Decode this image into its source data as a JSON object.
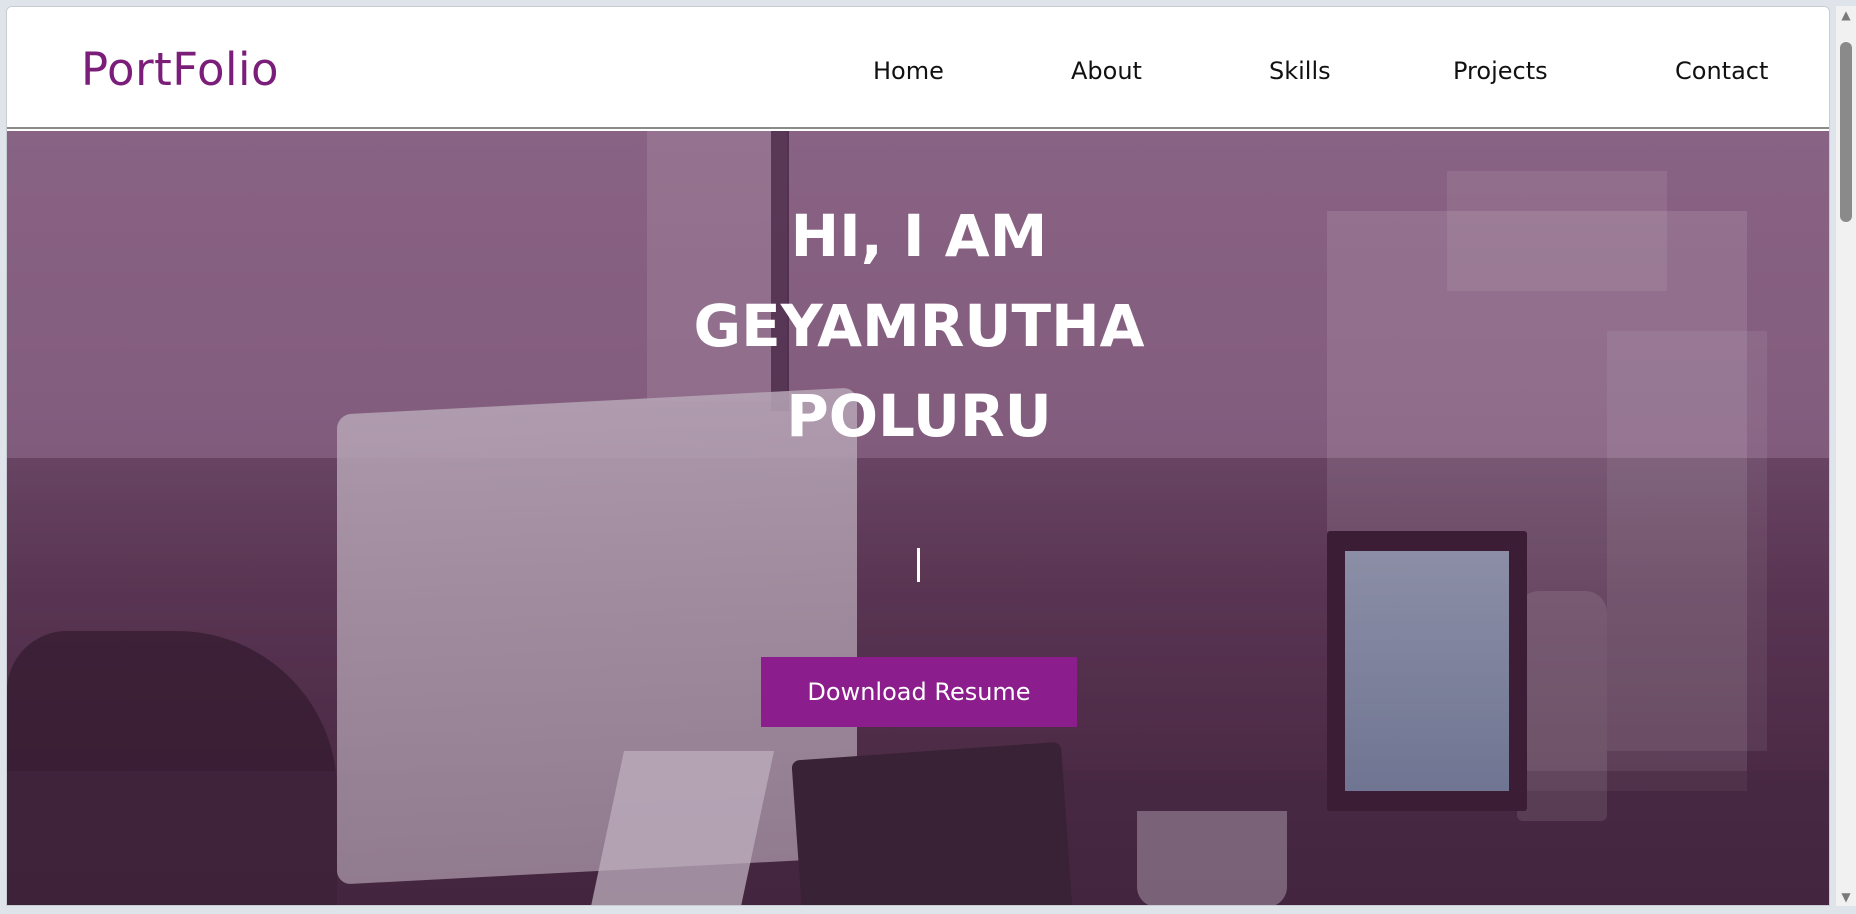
{
  "navbar": {
    "logo": "PortFolio",
    "items": [
      {
        "label": "Home"
      },
      {
        "label": "About"
      },
      {
        "label": "Skills"
      },
      {
        "label": "Projects"
      },
      {
        "label": "Contact"
      }
    ]
  },
  "hero": {
    "title_lines": [
      "HI, I AM",
      "GEYAMRUTHA",
      "POLURU"
    ],
    "button_label": "Download Resume"
  },
  "colors": {
    "brand": "#7b1e7a",
    "button": "#8b1d8c",
    "overlay": "#866080"
  },
  "icons": {
    "scroll_up": "triangle-up-icon",
    "scroll_down": "triangle-down-icon"
  }
}
